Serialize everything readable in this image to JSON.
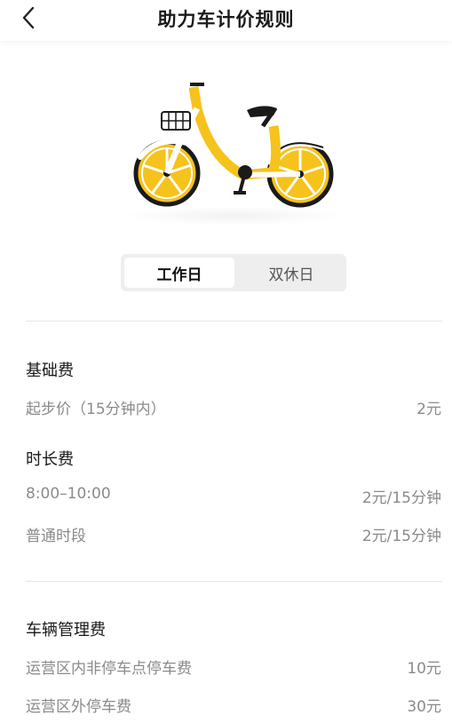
{
  "header": {
    "title": "助力车计价规则"
  },
  "tabs": [
    {
      "label": "工作日",
      "active": true
    },
    {
      "label": "双休日",
      "active": false
    }
  ],
  "colors": {
    "accent": "#F6C21C",
    "tab_bg": "#EEEEEE"
  },
  "sections": [
    {
      "title": "基础费",
      "rows": [
        {
          "label": "起步价（15分钟内）",
          "value": "2元"
        }
      ]
    },
    {
      "title": "时长费",
      "rows": [
        {
          "label": "8:00–10:00",
          "value": "2元/15分钟"
        },
        {
          "label": "普通时段",
          "value": "2元/15分钟"
        }
      ]
    },
    {
      "title": "车辆管理费",
      "rows": [
        {
          "label": "运营区内非停车点停车费",
          "value": "10元"
        },
        {
          "label": "运营区外停车费",
          "value": "30元"
        }
      ]
    }
  ]
}
